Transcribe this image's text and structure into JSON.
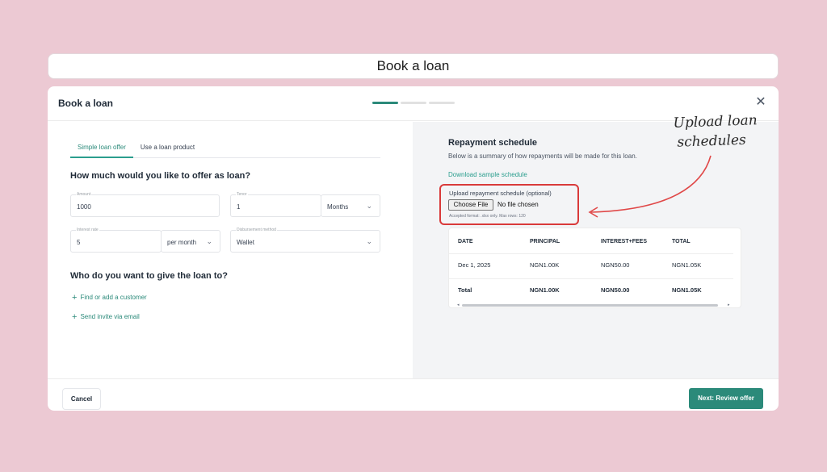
{
  "banner": {
    "title": "Book a loan"
  },
  "modal": {
    "title": "Book a loan",
    "steps": {
      "total": 3,
      "active": 1
    },
    "close_icon": "close-icon"
  },
  "tabs": [
    {
      "label": "Simple loan offer",
      "active": true
    },
    {
      "label": "Use a loan product",
      "active": false
    }
  ],
  "form": {
    "question_amount": "How much would you like to offer as loan?",
    "amount": {
      "label": "Amount",
      "value": "1000"
    },
    "tenor": {
      "label": "Tenor",
      "value": "1",
      "unit": "Months"
    },
    "interest": {
      "label": "Interest rate",
      "value": "5",
      "unit": "per month"
    },
    "disbursement": {
      "label": "Disbursement method",
      "value": "Wallet"
    },
    "question_customer": "Who do you want to give the loan to?",
    "find_customer": "Find or add a customer",
    "send_invite": "Send invite via email"
  },
  "repayment": {
    "title": "Repayment schedule",
    "subtitle": "Below is a summary of how repayments will be made for this loan.",
    "download_link": "Download sample schedule",
    "upload_label": "Upload repayment schedule (optional)",
    "choose_file": "Choose File",
    "no_file": "No file chosen",
    "accepted": "Accepted format: .xlsx only. Max rows: 120",
    "columns": [
      "DATE",
      "PRINCIPAL",
      "INTEREST+FEES",
      "TOTAL"
    ],
    "rows": [
      [
        "Dec 1, 2025",
        "NGN1.00K",
        "NGN50.00",
        "NGN1.05K"
      ]
    ],
    "total_row": [
      "Total",
      "NGN1.00K",
      "NGN50.00",
      "NGN1.05K"
    ]
  },
  "annotation": {
    "line1": "Upload loan",
    "line2": "schedules",
    "color": "#e04848"
  },
  "footer": {
    "cancel": "Cancel",
    "next": "Next: Review offer"
  },
  "colors": {
    "accent": "#2b8a7a",
    "highlight": "#d93a3a",
    "background": "#ecc9d3"
  }
}
